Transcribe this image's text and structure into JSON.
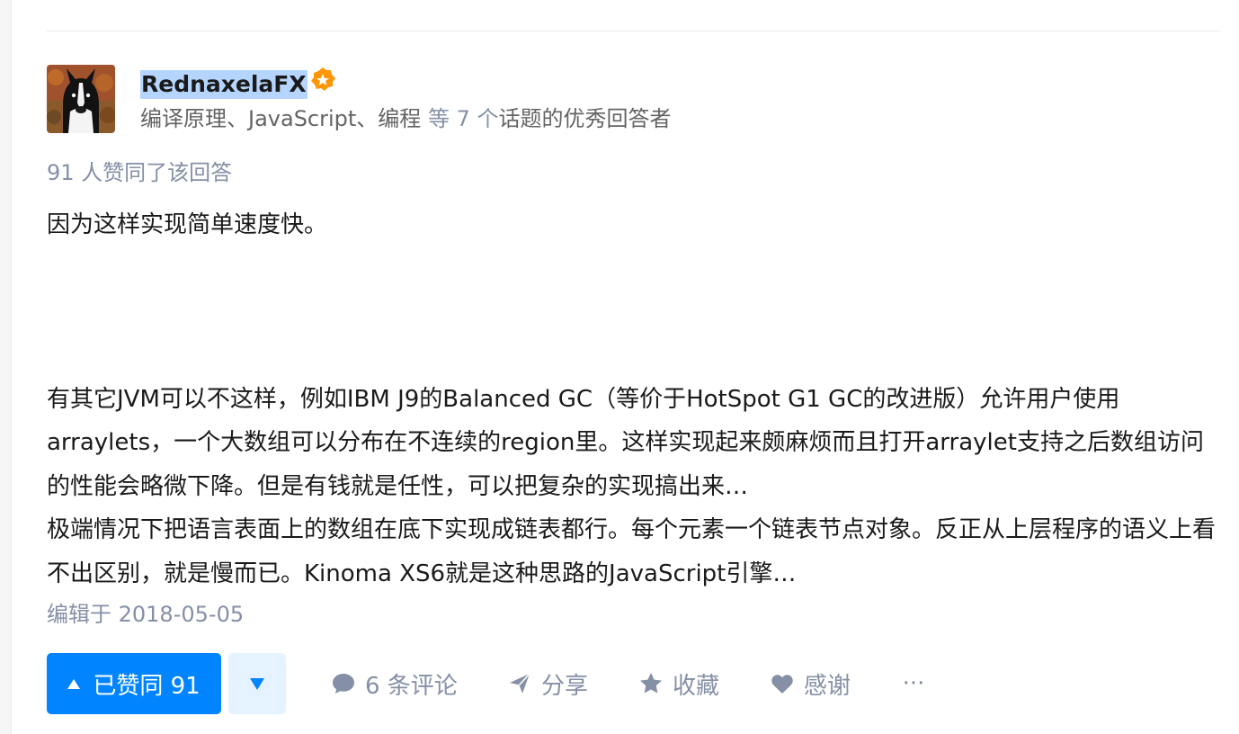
{
  "author": {
    "name": "RednaxelaFX",
    "headline_prefix": "编译原理、JavaScript、编程",
    "headline_link": " 等 7 个",
    "headline_suffix": "话题的优秀回答者"
  },
  "vote_summary": "91 人赞同了该回答",
  "answer": {
    "paragraphs": [
      "因为这样实现简单速度快。",
      "有其它JVM可以不这样，例如IBM J9的Balanced GC（等价于HotSpot G1 GC的改进版）允许用户使用arraylets，一个大数组可以分布在不连续的region里。这样实现起来颇麻烦而且打开arraylet支持之后数组访问的性能会略微下降。但是有钱就是任性，可以把复杂的实现搞出来…",
      "极端情况下把语言表面上的数组在底下实现成链表都行。每个元素一个链表节点对象。反正从上层程序的语义上看不出区别，就是慢而已。Kinoma XS6就是这种思路的JavaScript引擎…"
    ]
  },
  "edit_time": "编辑于 2018-05-05",
  "actions": {
    "vote_up_label": "已赞同 91",
    "comment_label": "6 条评论",
    "share_label": "分享",
    "collect_label": "收藏",
    "thanks_label": "感谢",
    "more_label": "···"
  },
  "colors": {
    "accent": "#0084ff",
    "muted": "#8590a6",
    "badge": "#ff9607"
  }
}
